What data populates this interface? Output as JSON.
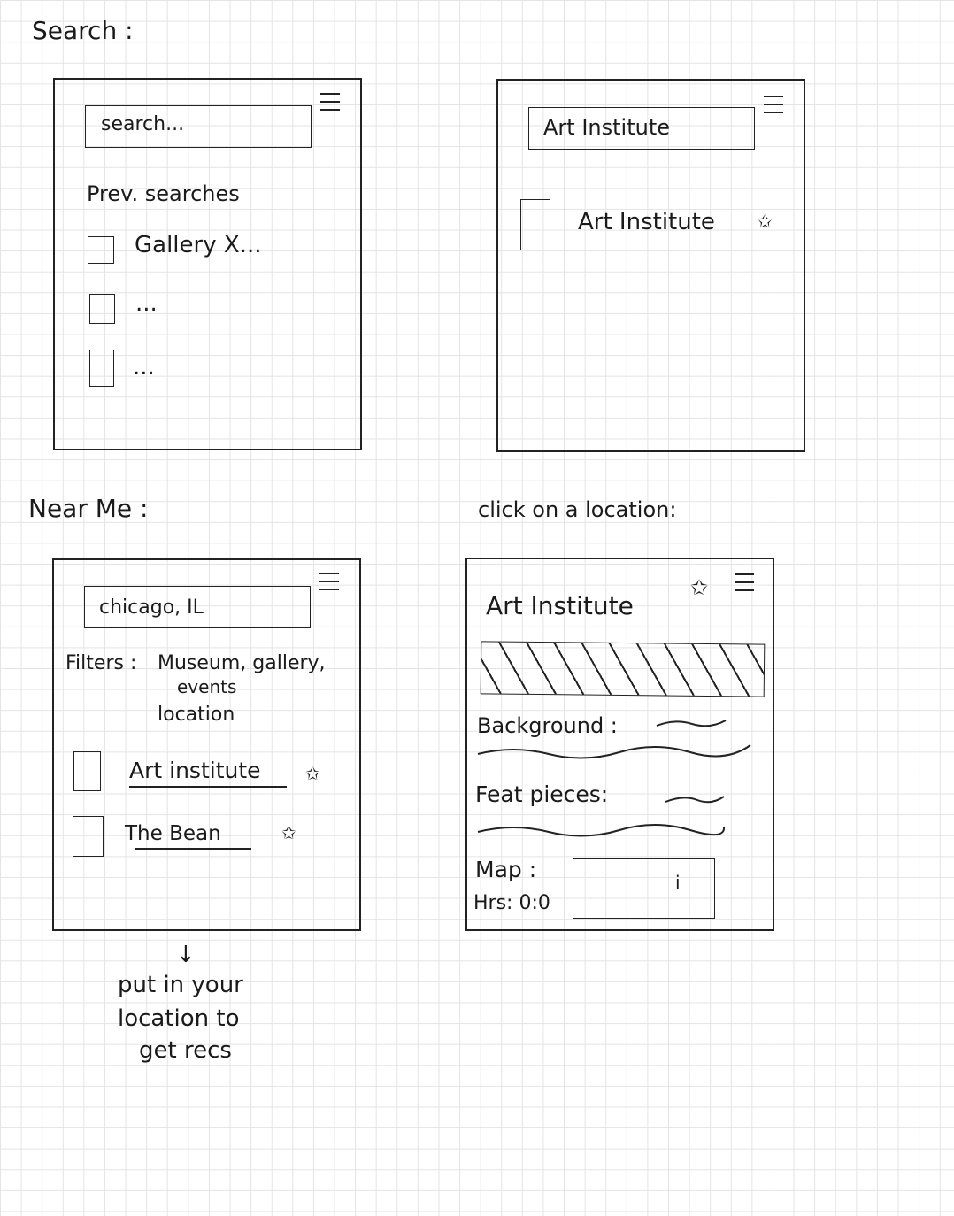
{
  "sections": {
    "search": "Search :",
    "near_me": "Near Me :",
    "click_location": "click on a location:"
  },
  "panel1": {
    "search_placeholder": "search...",
    "prev_searches": "Prev. searches",
    "items": [
      "Gallery X...",
      "...",
      "..."
    ]
  },
  "panel2": {
    "search_value": "Art Institute",
    "result": "Art Institute"
  },
  "panel3": {
    "location_value": "chicago, IL",
    "filters_label": "Filters :",
    "filters_values": "Museum, gallery,",
    "filters_line2": "events",
    "filters_line3": "location",
    "results": [
      "Art institute",
      "The Bean"
    ]
  },
  "panel4": {
    "title": "Art Institute",
    "background_label": "Background :",
    "feat_label": "Feat pieces:",
    "map_label": "Map :",
    "hours_label": "Hrs: 0:0"
  },
  "note": {
    "arrow": "↓",
    "line1": "put in your",
    "line2": "location to",
    "line3": "get recs"
  },
  "icons": {
    "menu": "hamburger-icon",
    "star": "star-icon",
    "checkbox": "checkbox-icon",
    "map_pin": "map-pin-icon"
  }
}
